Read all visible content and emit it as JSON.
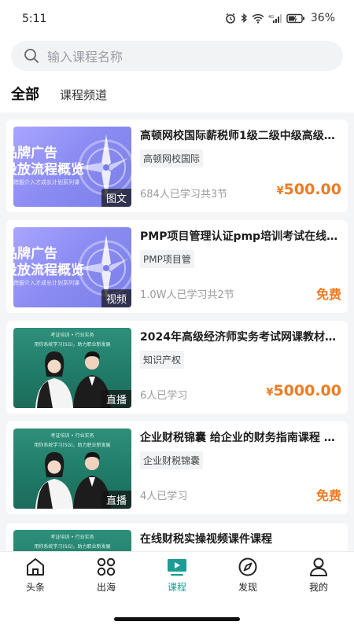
{
  "status_bar": {
    "time": "5:11",
    "battery": "36%"
  },
  "search": {
    "placeholder": "输入课程名称"
  },
  "tabs": [
    {
      "label": "全部",
      "active": true
    },
    {
      "label": "课程频道",
      "active": false
    }
  ],
  "courses": [
    {
      "title": "高顿网校国际薪税师1级二级中级高级CC...",
      "tag": "高顿网校国际",
      "stats": "684人已学习共3节",
      "price_symbol": "¥",
      "price": "500.00",
      "type_badge": "图文",
      "thumb_text": [
        "品牌广告",
        "投放流程概览"
      ],
      "thumb_sub": "跨服介入才成长计划系列课"
    },
    {
      "title": "PMP项目管理认证pmp培训考试在线远...",
      "tag": "PMP项目管",
      "stats": "1.0W人已学习共2节",
      "price_free": "免费",
      "type_badge": "视频",
      "thumb_text": [
        "品牌广告",
        "投放流程概览"
      ],
      "thumb_sub": "跨服介入才成长计划系列课"
    },
    {
      "title": "2024年高级经济师实务考试网课教材视...",
      "tag": "知识产权",
      "stats": "6人已学习",
      "price_symbol": "¥",
      "price": "5000.00",
      "type_badge": "直播",
      "thumb_top": "考证培训 • 行业实务",
      "thumb_sub": "用你系统学习(SG)，助力职业新发展"
    },
    {
      "title": "企业财税锦囊 给企业的财务指南课程 企...",
      "tag": "企业财税锦囊",
      "stats": "4人已学习",
      "price_free": "免费",
      "type_badge": "直播",
      "thumb_top": "考证培训 • 行业实务",
      "thumb_sub": "用你系统学习(SG)，助力职业新发展"
    },
    {
      "title": "在线财税实操视频课件课程",
      "thumb_top": "考证培训 • 行业实务",
      "thumb_sub": "用你系统学习(SG)，助力职业新发展"
    }
  ],
  "bottom_nav": [
    {
      "label": "头条",
      "icon": "home-icon",
      "active": false
    },
    {
      "label": "出海",
      "icon": "apps-icon",
      "active": false
    },
    {
      "label": "课程",
      "icon": "tv-play-icon",
      "active": true
    },
    {
      "label": "发现",
      "icon": "compass-icon",
      "active": false
    },
    {
      "label": "我的",
      "icon": "person-icon",
      "active": false
    }
  ],
  "colors": {
    "accent": "#1b9d94",
    "price": "#ee7b23",
    "background": "#f4f5f7"
  }
}
